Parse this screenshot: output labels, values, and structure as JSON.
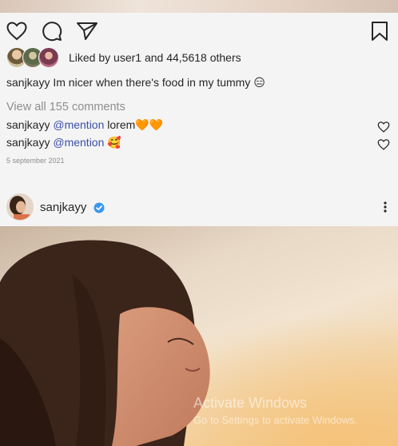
{
  "post": {
    "liked_by_prefix": "Liked by",
    "liked_user": "user1",
    "liked_and": "and",
    "liked_count": "44,5618",
    "liked_suffix": "others",
    "caption_user": "sanjkayy",
    "caption_text": "Im nicer when there's food in my tummy",
    "caption_emoji": "😑",
    "view_all_comments": "View all 155 comments",
    "comments": [
      {
        "user": "sanjkayy",
        "mention": "@mention",
        "text": "lorem",
        "emoji": "🧡🧡"
      },
      {
        "user": "sanjkayy",
        "mention": "@mention",
        "text": "",
        "emoji": "🥰"
      }
    ],
    "date": "5 september 2021"
  },
  "next_post": {
    "username": "sanjkayy"
  },
  "watermark": {
    "title": "Activate Windows",
    "subtitle": "Go to Settings to activate Windows."
  },
  "icons": {
    "like": "heart-icon",
    "comment": "comment-icon",
    "share": "send-icon",
    "save": "bookmark-icon",
    "comment_like": "heart-icon",
    "verified": "verified-badge-icon",
    "more": "more-options-icon"
  },
  "colors": {
    "mention": "#3b4fa8",
    "verified": "#3897f0",
    "muted": "#8e8e8e"
  }
}
